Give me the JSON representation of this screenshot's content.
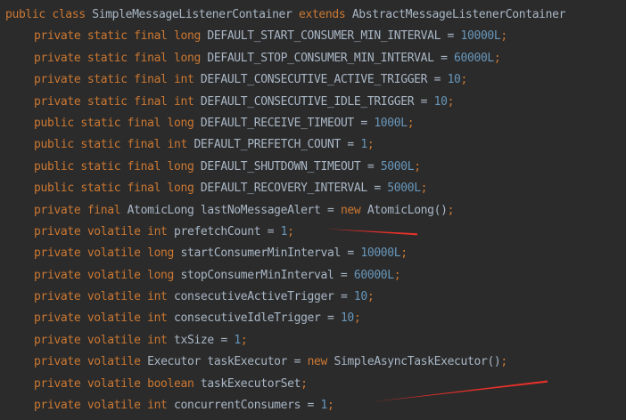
{
  "colors": {
    "background": "#2b2b2b",
    "keyword": "#cc7832",
    "number": "#6897bb",
    "identifier": "#a9b7c6",
    "annotation_arrow": "#e8302a"
  },
  "code": {
    "class_line": {
      "kw1": "public class",
      "name": " SimpleMessageListenerContainer ",
      "kw2": "extends",
      "parent": " AbstractMessageListenerContainer"
    },
    "lines": [
      {
        "mods": "private static final long",
        "name": " DEFAULT_START_CONSUMER_MIN_INTERVAL = ",
        "value": "10000L",
        "end": ";"
      },
      {
        "mods": "private static final long",
        "name": " DEFAULT_STOP_CONSUMER_MIN_INTERVAL = ",
        "value": "60000L",
        "end": ";"
      },
      {
        "mods": "private static final int",
        "name": " DEFAULT_CONSECUTIVE_ACTIVE_TRIGGER = ",
        "value": "10",
        "end": ";"
      },
      {
        "mods": "private static final int",
        "name": " DEFAULT_CONSECUTIVE_IDLE_TRIGGER = ",
        "value": "10",
        "end": ";"
      },
      {
        "mods": "public static final long",
        "name": " DEFAULT_RECEIVE_TIMEOUT = ",
        "value": "1000L",
        "end": ";"
      },
      {
        "mods": "public static final int",
        "name": " DEFAULT_PREFETCH_COUNT = ",
        "value": "1",
        "end": ";"
      },
      {
        "mods": "public static final long",
        "name": " DEFAULT_SHUTDOWN_TIMEOUT = ",
        "value": "5000L",
        "end": ";"
      },
      {
        "mods": "public static final long",
        "name": " DEFAULT_RECOVERY_INTERVAL = ",
        "value": "5000L",
        "end": ";"
      },
      {
        "mods": "private final",
        "name": " AtomicLong lastNoMessageAlert = ",
        "value_kw": "new",
        "value_rest": " AtomicLong()",
        "end": ";"
      },
      {
        "mods": "private volatile int",
        "name": " prefetchCount = ",
        "value": "1",
        "end": ";"
      },
      {
        "mods": "private volatile long",
        "name": " startConsumerMinInterval = ",
        "value": "10000L",
        "end": ";"
      },
      {
        "mods": "private volatile long",
        "name": " stopConsumerMinInterval = ",
        "value": "60000L",
        "end": ";"
      },
      {
        "mods": "private volatile int",
        "name": " consecutiveActiveTrigger = ",
        "value": "10",
        "end": ";"
      },
      {
        "mods": "private volatile int",
        "name": " consecutiveIdleTrigger = ",
        "value": "10",
        "end": ";"
      },
      {
        "mods": "private volatile int",
        "name": " txSize = ",
        "value": "1",
        "end": ";"
      },
      {
        "mods": "private volatile",
        "name": " Executor taskExecutor = ",
        "value_kw": "new",
        "value_rest": " SimpleAsyncTaskExecutor()",
        "end": ";"
      },
      {
        "mods": "private volatile boolean",
        "name": " taskExecutorSet",
        "end": ";"
      },
      {
        "mods": "private volatile int",
        "name": " concurrentConsumers = ",
        "value": "1",
        "end": ";"
      }
    ]
  }
}
